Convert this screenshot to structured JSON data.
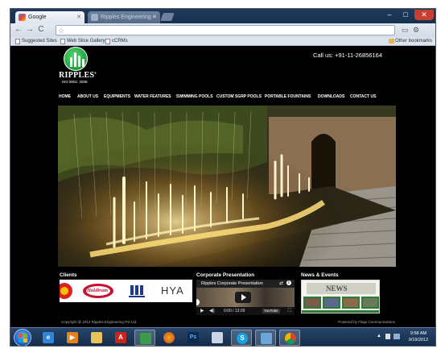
{
  "browser": {
    "tabs": [
      {
        "title": "Google",
        "active": true
      },
      {
        "title": "Ripples Engineering - Pag",
        "active": false
      }
    ],
    "omnibox_value": "",
    "bookmarks": [
      "Suggested Sites",
      "Web Slice Gallery",
      "cCRMs"
    ],
    "other_bookmarks": "Other bookmarks"
  },
  "site": {
    "logo_name": "RIPPLES",
    "logo_reg": "®",
    "logo_iso": "ISO 9001: 2008",
    "call_us": "Call us: +91-11-26856164",
    "nav": [
      "HOME",
      "ABOUT US",
      "EQUIPMENTS",
      "WATER FEATURES",
      "SWIMMING POOLS",
      "CUSTOM SGRP POOLS",
      "PORTABLE FOUNTAINS",
      "DOWNLOADS",
      "CONTACT US"
    ],
    "clients_title": "Clients",
    "client_logos": [
      "Haldiram",
      "HYA"
    ],
    "corporate_title": "Corporate Presentation",
    "video": {
      "title": "Ripples Corporate Presentation",
      "time": "0:00 / 13:09",
      "badge": "YouTube"
    },
    "news_title": "News & Events",
    "copyright": "Copyright @ 2014 Ripples Engineering Pvt Ltd",
    "powered_by": "Powered by Flags Communications"
  },
  "taskbar": {
    "apps": [
      "explorer",
      "ie",
      "media-player",
      "folder",
      "pdf",
      "notepad",
      "firefox",
      "photoshop",
      "files",
      "skype",
      "outlook",
      "chrome"
    ],
    "clock_time": "9:58 AM",
    "clock_date": "9/19/2012"
  },
  "colors": {
    "site_bg": "#000000",
    "logo_green": "#0a8a2a",
    "taskbar": "#1a3558"
  }
}
